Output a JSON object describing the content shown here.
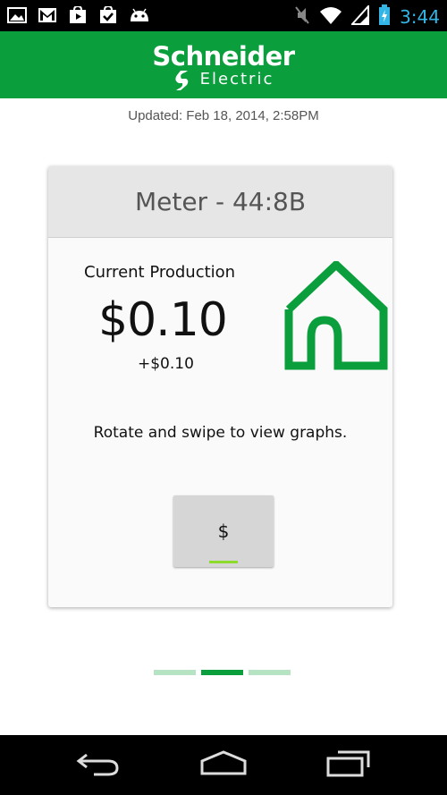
{
  "status_bar": {
    "time": "3:44",
    "left_icons": [
      "gallery-icon",
      "gmail-icon",
      "play-store-icon",
      "task-icon",
      "android-icon"
    ],
    "right_icons": [
      "mute-icon",
      "wifi-icon",
      "signal-icon",
      "battery-charging-icon"
    ]
  },
  "header": {
    "logo_main": "Schneider",
    "logo_sub": "Electric",
    "brand_color": "#0a9e3c"
  },
  "updated_text": "Updated: Feb 18, 2014, 2:58PM",
  "card": {
    "title": "Meter - 44:8B",
    "production_label": "Current Production",
    "production_value": "$0.10",
    "production_delta": "+$0.10",
    "hint": "Rotate and swipe to view graphs.",
    "currency_button": "$",
    "house_icon": "house-icon",
    "accent_color": "#8ddc2d"
  },
  "pager": {
    "pages": 3,
    "active_index": 1
  },
  "nav_bar": {
    "buttons": [
      "back-icon",
      "home-icon",
      "recent-apps-icon"
    ]
  }
}
